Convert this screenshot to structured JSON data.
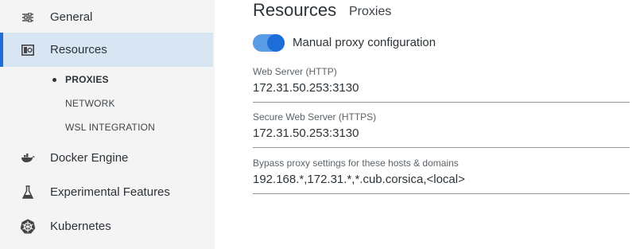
{
  "sidebar": {
    "items": [
      {
        "label": "General",
        "icon": "sliders-icon"
      },
      {
        "label": "Resources",
        "icon": "resources-icon"
      },
      {
        "label": "Docker Engine",
        "icon": "whale-icon"
      },
      {
        "label": "Experimental Features",
        "icon": "flask-icon"
      },
      {
        "label": "Kubernetes",
        "icon": "helm-wheel-icon"
      }
    ],
    "subitems": [
      {
        "label": "PROXIES"
      },
      {
        "label": "NETWORK"
      },
      {
        "label": "WSL INTEGRATION"
      }
    ]
  },
  "main": {
    "title": "Resources",
    "subtitle": "Proxies",
    "toggle": {
      "label": "Manual proxy configuration",
      "on": true
    },
    "fields": [
      {
        "label": "Web Server (HTTP)",
        "value": "172.31.50.253:3130"
      },
      {
        "label": "Secure Web Server (HTTPS)",
        "value": "172.31.50.253:3130"
      },
      {
        "label": "Bypass proxy settings for these hosts & domains",
        "value": "192.168.*,172.31.*,*.cub.corsica,<local>"
      }
    ]
  },
  "colors": {
    "accent": "#1d6ed8",
    "active_bg": "#d7e6f2",
    "sidebar_bg": "#f4f4f5"
  }
}
